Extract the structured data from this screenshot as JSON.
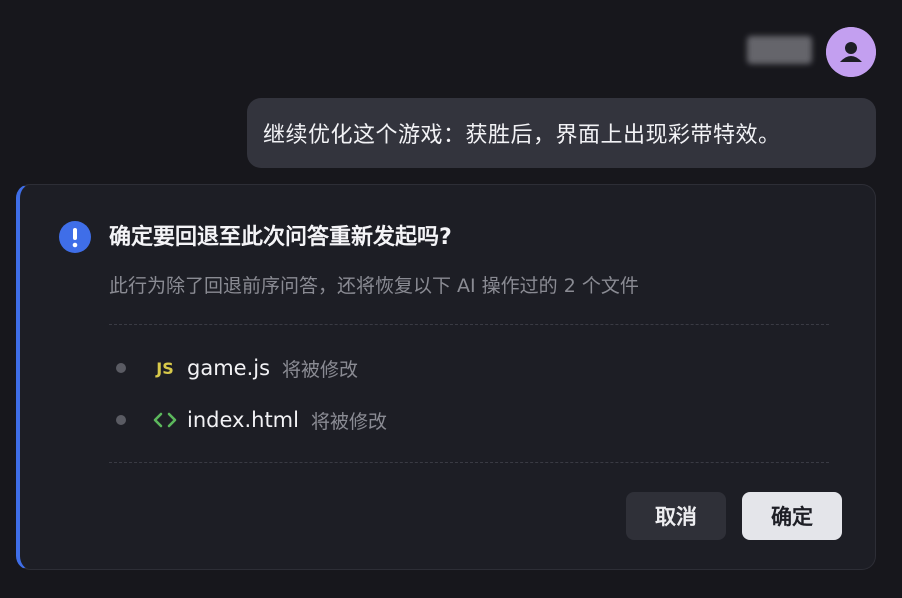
{
  "header": {
    "avatar_icon": "user-icon",
    "avatar_color": "#c39ff0"
  },
  "message": {
    "text": "继续优化这个游戏：获胜后，界面上出现彩带特效。"
  },
  "dialog": {
    "icon": "exclamation-circle-icon",
    "accent_color": "#3f6ee8",
    "title": "确定要回退至此次问答重新发起吗?",
    "description": "此行为除了回退前序问答，还将恢复以下 AI 操作过的 2 个文件",
    "files": [
      {
        "icon": "js-file-icon",
        "icon_text": "JS",
        "name": "game.js",
        "status": "将被修改"
      },
      {
        "icon": "html-code-icon",
        "name": "index.html",
        "status": "将被修改"
      }
    ],
    "cancel_label": "取消",
    "confirm_label": "确定"
  }
}
